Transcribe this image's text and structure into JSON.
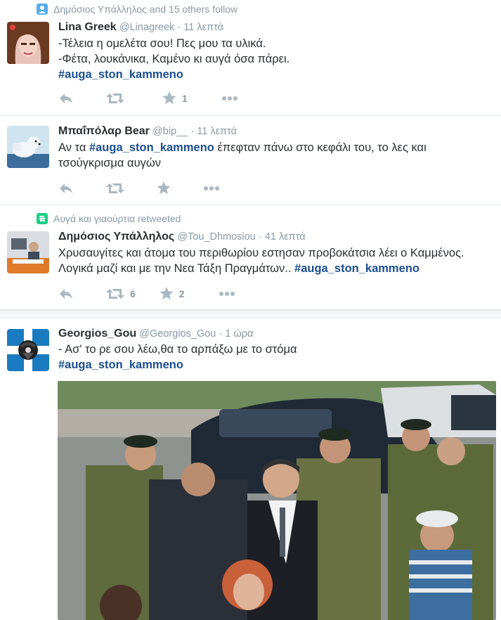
{
  "colors": {
    "hashtag": "#1b4e8f",
    "muted": "#8899a6",
    "icon": "#aab8c2",
    "retweet_green": "#19cf86",
    "follow_blue": "#55acee"
  },
  "tweets": [
    {
      "context": "Δημόσιος Υπάλληλος and 15 others follow",
      "context_icon": "person-icon",
      "name": "Lina Greek",
      "handle": "@Linagreek",
      "time": "11 λεπτά",
      "line1": "-Τέλεια η ομελέτα σου! Πες μου τα υλικά.",
      "line2": "-Φέτα, λουκάνικα, Καμένο κι αυγά όσα πάρει.",
      "hashtag": "#auga_ston_kammeno",
      "retweets": "",
      "likes": "1"
    },
    {
      "name": "Μπαΐπόλαρ Bear",
      "handle": "@bip__",
      "time": "11 λεπτά",
      "text_pre": "Αν τα ",
      "hashtag": "#auga_ston_kammeno",
      "text_post": " έπεφταν πάνω στο κεφάλι του, το λες και",
      "line2": "τσούγκρισμα αυγών",
      "retweets": "",
      "likes": ""
    },
    {
      "context": "Αυγά και γιαούρτια retweeted",
      "context_icon": "retweet-icon",
      "name": "Δημόσιος Υπάλληλος",
      "handle": "@Tou_Dhmosiou",
      "time": "41 λεπτά",
      "line1": "Χρυσαυγίτες και άτομα του περιθωρίου εστησαν προβοκάτσια λέει ο Καμμένος.",
      "line2_pre": "Λογικά μαζί και με την Νεα Τάξη Πραγμάτων.. ",
      "hashtag": "#auga_ston_kammeno",
      "retweets": "6",
      "likes": "2"
    },
    {
      "name": "Georgios_Gou",
      "handle": "@Georgios_Gou",
      "time": "1 ώρα",
      "line1": "- Ασ' το ρε σου λέω,θα το αρπάξω με το στόμα",
      "hashtag": "#auga_ston_kammeno"
    }
  ]
}
